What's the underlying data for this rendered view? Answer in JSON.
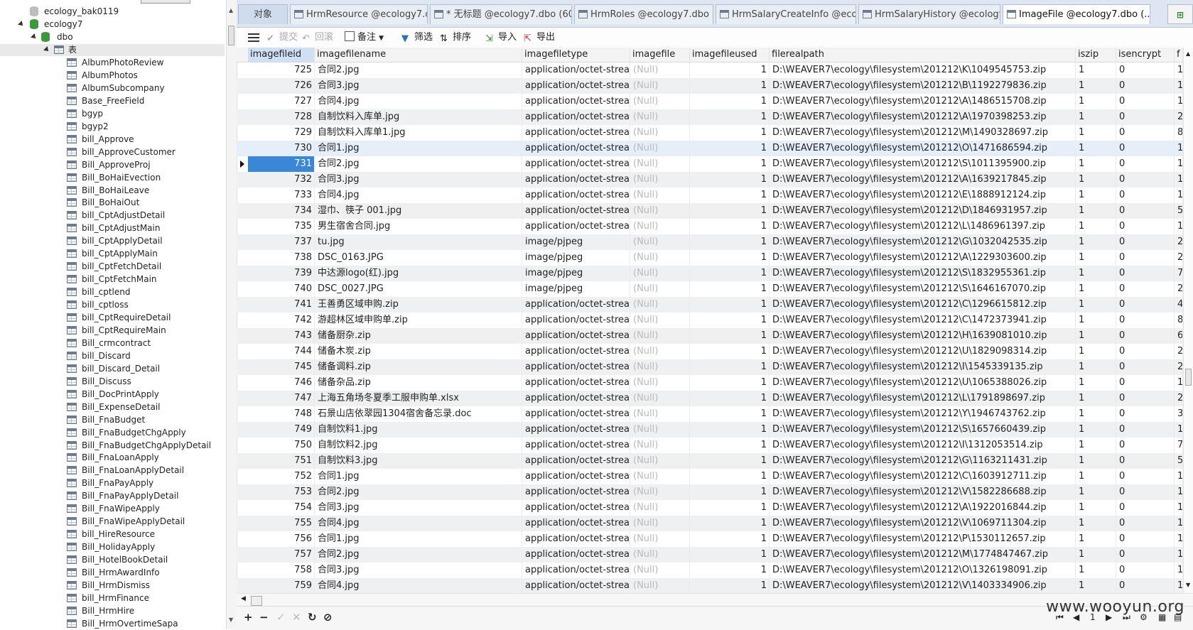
{
  "sidebar": {
    "nodes": [
      {
        "label": "ecology_bak0119",
        "kind": "db-gray"
      },
      {
        "label": "ecology7",
        "kind": "db-green"
      },
      {
        "label": "dbo",
        "kind": "schema"
      },
      {
        "label": "表",
        "kind": "folder"
      }
    ],
    "tables": [
      "AlbumPhotoReview",
      "AlbumPhotos",
      "AlbumSubcompany",
      "Base_FreeField",
      "bgyp",
      "bgyp2",
      "bill_Approve",
      "bill_ApproveCustomer",
      "Bill_ApproveProj",
      "Bill_BoHaiEvection",
      "Bill_BoHaiLeave",
      "Bill_BoHaiOut",
      "bill_CptAdjustDetail",
      "bill_CptAdjustMain",
      "bill_CptApplyDetail",
      "bill_CptApplyMain",
      "bill_CptFetchDetail",
      "bill_CptFetchMain",
      "bill_cptlend",
      "bill_cptloss",
      "bill_CptRequireDetail",
      "bill_CptRequireMain",
      "Bill_crmcontract",
      "bill_Discard",
      "bill_Discard_Detail",
      "Bill_Discuss",
      "Bill_DocPrintApply",
      "Bill_ExpenseDetail",
      "Bill_FnaBudget",
      "Bill_FnaBudgetChgApply",
      "Bill_FnaBudgetChgApplyDetail",
      "Bill_FnaLoanApply",
      "Bill_FnaLoanApplyDetail",
      "Bill_FnaPayApply",
      "Bill_FnaPayApplyDetail",
      "Bill_FnaWipeApply",
      "Bill_FnaWipeApplyDetail",
      "bill_HireResource",
      "Bill_HolidayApply",
      "Bill_HotelBookDetail",
      "Bill_HrmAwardInfo",
      "Bill_HrmDismiss",
      "bill_HrmFinance",
      "Bill_HrmHire",
      "Bill_HrmOvertimeSapa"
    ]
  },
  "tabs": [
    {
      "label": "对象",
      "kind": "objects"
    },
    {
      "label": "HrmResource @ecology7.d..."
    },
    {
      "label": "* 无标题 @ecology7.dbo (60..."
    },
    {
      "label": "HrmRoles @ecology7.dbo (..."
    },
    {
      "label": "HrmSalaryCreateInfo @ecol..."
    },
    {
      "label": "HrmSalaryHistory @ecology..."
    },
    {
      "label": "ImageFile @ecology7.dbo (...",
      "active": true
    }
  ],
  "toolbar": {
    "commit": "提交",
    "rollback": "回滚",
    "note": "备注",
    "filter": "筛选",
    "sort": "排序",
    "import": "导入",
    "export": "导出"
  },
  "grid": {
    "columns": [
      "imagefileid",
      "imagefilename",
      "imagefiletype",
      "imagefile",
      "imagefileused",
      "filerealpath",
      "iszip",
      "isencrypt",
      "f"
    ],
    "null_text": "(Null)",
    "selected_row": 731,
    "rows": [
      [
        725,
        "合同2.jpg",
        "application/octet-stream",
        1,
        "D:\\WEAVER7\\ecology\\filesystem\\201212\\K\\1049545753.zip",
        1,
        0,
        "1"
      ],
      [
        726,
        "合同3.jpg",
        "application/octet-stream",
        1,
        "D:\\WEAVER7\\ecology\\filesystem\\201212\\B\\1192279836.zip",
        1,
        0,
        "1"
      ],
      [
        727,
        "合同4.jpg",
        "application/octet-stream",
        1,
        "D:\\WEAVER7\\ecology\\filesystem\\201212\\A\\1486515708.zip",
        1,
        0,
        "1"
      ],
      [
        728,
        "自制饮料入库单.jpg",
        "application/octet-stream",
        1,
        "D:\\WEAVER7\\ecology\\filesystem\\201212\\A\\1970398253.zip",
        1,
        0,
        "2"
      ],
      [
        729,
        "自制饮料入库单1.jpg",
        "application/octet-stream",
        1,
        "D:\\WEAVER7\\ecology\\filesystem\\201212\\M\\1490328697.zip",
        1,
        0,
        "8"
      ],
      [
        730,
        "合同1.jpg",
        "application/octet-stream",
        1,
        "D:\\WEAVER7\\ecology\\filesystem\\201212\\O\\1471686594.zip",
        1,
        0,
        "1"
      ],
      [
        731,
        "合同2.jpg",
        "application/octet-stream",
        1,
        "D:\\WEAVER7\\ecology\\filesystem\\201212\\S\\1011395900.zip",
        1,
        0,
        "1"
      ],
      [
        732,
        "合同3.jpg",
        "application/octet-stream",
        1,
        "D:\\WEAVER7\\ecology\\filesystem\\201212\\A\\1639217845.zip",
        1,
        0,
        "1"
      ],
      [
        733,
        "合同4.jpg",
        "application/octet-stream",
        1,
        "D:\\WEAVER7\\ecology\\filesystem\\201212\\E\\1888912124.zip",
        1,
        0,
        "1"
      ],
      [
        734,
        "湿巾、筷子 001.jpg",
        "application/octet-stream",
        1,
        "D:\\WEAVER7\\ecology\\filesystem\\201212\\D\\1846931957.zip",
        1,
        0,
        "5"
      ],
      [
        735,
        "男生宿舍合同.jpg",
        "application/octet-stream",
        1,
        "D:\\WEAVER7\\ecology\\filesystem\\201212\\L\\1486961397.zip",
        1,
        0,
        "1"
      ],
      [
        737,
        "tu.jpg",
        "image/pjpeg",
        1,
        "D:\\WEAVER7\\ecology\\filesystem\\201212\\G\\1032042535.zip",
        1,
        0,
        "2"
      ],
      [
        738,
        "DSC_0163.JPG",
        "image/pjpeg",
        1,
        "D:\\WEAVER7\\ecology\\filesystem\\201212\\A\\1229303600.zip",
        1,
        0,
        "2"
      ],
      [
        739,
        "中达源logo(红).jpg",
        "image/pjpeg",
        1,
        "D:\\WEAVER7\\ecology\\filesystem\\201212\\S\\1832955361.zip",
        1,
        0,
        "7"
      ],
      [
        740,
        "DSC_0027.JPG",
        "image/pjpeg",
        1,
        "D:\\WEAVER7\\ecology\\filesystem\\201212\\S\\1646167070.zip",
        1,
        0,
        "2"
      ],
      [
        741,
        "王善勇区域申购.zip",
        "application/octet-stream",
        1,
        "D:\\WEAVER7\\ecology\\filesystem\\201212\\C\\1296615812.zip",
        1,
        0,
        "4"
      ],
      [
        742,
        "游超林区域申购单.zip",
        "application/octet-stream",
        1,
        "D:\\WEAVER7\\ecology\\filesystem\\201212\\C\\1472373941.zip",
        1,
        0,
        "8"
      ],
      [
        743,
        "储备厨杂.zip",
        "application/octet-stream",
        1,
        "D:\\WEAVER7\\ecology\\filesystem\\201212\\H\\1639081010.zip",
        1,
        0,
        "6"
      ],
      [
        744,
        "储备木炭.zip",
        "application/octet-stream",
        1,
        "D:\\WEAVER7\\ecology\\filesystem\\201212\\U\\1829098314.zip",
        1,
        0,
        "2"
      ],
      [
        745,
        "储备调料.zip",
        "application/octet-stream",
        1,
        "D:\\WEAVER7\\ecology\\filesystem\\201212\\I\\1545339135.zip",
        1,
        0,
        "2"
      ],
      [
        746,
        "储备杂品.zip",
        "application/octet-stream",
        1,
        "D:\\WEAVER7\\ecology\\filesystem\\201212\\U\\1065388026.zip",
        1,
        0,
        "1"
      ],
      [
        747,
        "上海五角场冬夏季工服申购单.xlsx",
        "application/octet-stream",
        1,
        "D:\\WEAVER7\\ecology\\filesystem\\201212\\L\\1791898697.zip",
        1,
        0,
        "2"
      ],
      [
        748,
        "石景山店依翠园1304宿舍备忘录.doc",
        "application/octet-stream",
        1,
        "D:\\WEAVER7\\ecology\\filesystem\\201212\\Y\\1946743762.zip",
        1,
        0,
        "3"
      ],
      [
        749,
        "自制饮料1.jpg",
        "application/octet-stream",
        1,
        "D:\\WEAVER7\\ecology\\filesystem\\201212\\S\\1657660439.zip",
        1,
        0,
        "1"
      ],
      [
        750,
        "自制饮料2.jpg",
        "application/octet-stream",
        1,
        "D:\\WEAVER7\\ecology\\filesystem\\201212\\I\\1312053514.zip",
        1,
        0,
        "7"
      ],
      [
        751,
        "自制饮料3.jpg",
        "application/octet-stream",
        1,
        "D:\\WEAVER7\\ecology\\filesystem\\201212\\G\\1163211431.zip",
        1,
        0,
        "5"
      ],
      [
        752,
        "合同1.jpg",
        "application/octet-stream",
        1,
        "D:\\WEAVER7\\ecology\\filesystem\\201212\\C\\1603912711.zip",
        1,
        0,
        "1"
      ],
      [
        753,
        "合同2.jpg",
        "application/octet-stream",
        1,
        "D:\\WEAVER7\\ecology\\filesystem\\201212\\V\\1582286688.zip",
        1,
        0,
        "1"
      ],
      [
        754,
        "合同3.jpg",
        "application/octet-stream",
        1,
        "D:\\WEAVER7\\ecology\\filesystem\\201212\\A\\1922016844.zip",
        1,
        0,
        "1"
      ],
      [
        755,
        "合同4.jpg",
        "application/octet-stream",
        1,
        "D:\\WEAVER7\\ecology\\filesystem\\201212\\V\\1069711304.zip",
        1,
        0,
        "1"
      ],
      [
        756,
        "合同1.jpg",
        "application/octet-stream",
        1,
        "D:\\WEAVER7\\ecology\\filesystem\\201212\\P\\1530112657.zip",
        1,
        0,
        "1"
      ],
      [
        757,
        "合同2.jpg",
        "application/octet-stream",
        1,
        "D:\\WEAVER7\\ecology\\filesystem\\201212\\M\\1774847467.zip",
        1,
        0,
        "1"
      ],
      [
        758,
        "合同3.jpg",
        "application/octet-stream",
        1,
        "D:\\WEAVER7\\ecology\\filesystem\\201212\\O\\1326198091.zip",
        1,
        0,
        "1"
      ],
      [
        759,
        "合同4.jpg",
        "application/octet-stream",
        1,
        "D:\\WEAVER7\\ecology\\filesystem\\201212\\V\\1403334906.zip",
        1,
        0,
        "1"
      ]
    ]
  },
  "pager": {
    "page": "1"
  },
  "watermark": "www.wooyun.org",
  "colors": {
    "selection": "#3a87d8",
    "tabbar": "#dde6f2",
    "null_text": "#b9b9b9"
  }
}
